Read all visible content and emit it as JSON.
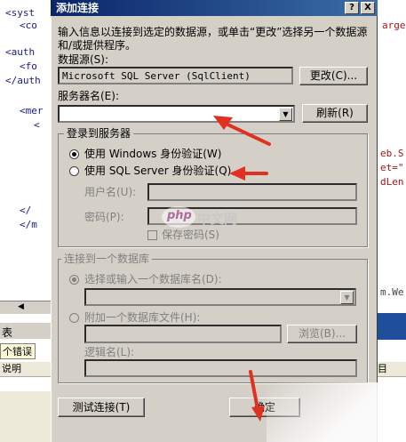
{
  "ide": {
    "code_lines": [
      "<syst",
      "<co",
      "<auth",
      "<fo",
      "</auth",
      "<mer",
      "<"
    ],
    "code_lines_right": [
      "arge",
      "eb.S",
      "et=\"",
      "dLen",
      "m.We"
    ],
    "lower_lines": [
      "</",
      "</m"
    ],
    "bottom_tab1": "表",
    "bottom_tab2": "个错误",
    "col_label": "说明",
    "col_right": "目"
  },
  "dialog": {
    "title": "添加连接",
    "help_btn": "?",
    "close_btn": "X",
    "intro": "输入信息以连接到选定的数据源，或单击“更改”选择另一个数据源和/或提供程序。",
    "datasource_label": "数据源(S):",
    "datasource_value": "Microsoft SQL Server (SqlClient)",
    "change_btn": "更改(C)...",
    "server_label": "服务器名(E):",
    "server_value": "",
    "refresh_btn": "刷新(R)",
    "login_group": "登录到服务器",
    "auth_windows": "使用 Windows 身份验证(W)",
    "auth_sql": "使用 SQL Server 身份验证(Q)",
    "username_label": "用户名(U):",
    "password_label": "密码(P):",
    "save_password": "保存密码(S)",
    "db_group": "连接到一个数据库",
    "db_select_label": "选择或输入一个数据库名(D):",
    "db_attach_label": "附加一个数据库文件(H):",
    "browse_btn": "浏览(B)...",
    "logical_name_label": "逻辑名(L):",
    "test_btn": "测试连接(T)",
    "ok_btn": "确定"
  },
  "watermark": {
    "logo_text": "php",
    "site_text": "中文网"
  },
  "colors": {
    "title_bar": "#0a246a",
    "dialog_face": "#d4d0c8",
    "annotation_arrow": "#e03020"
  }
}
